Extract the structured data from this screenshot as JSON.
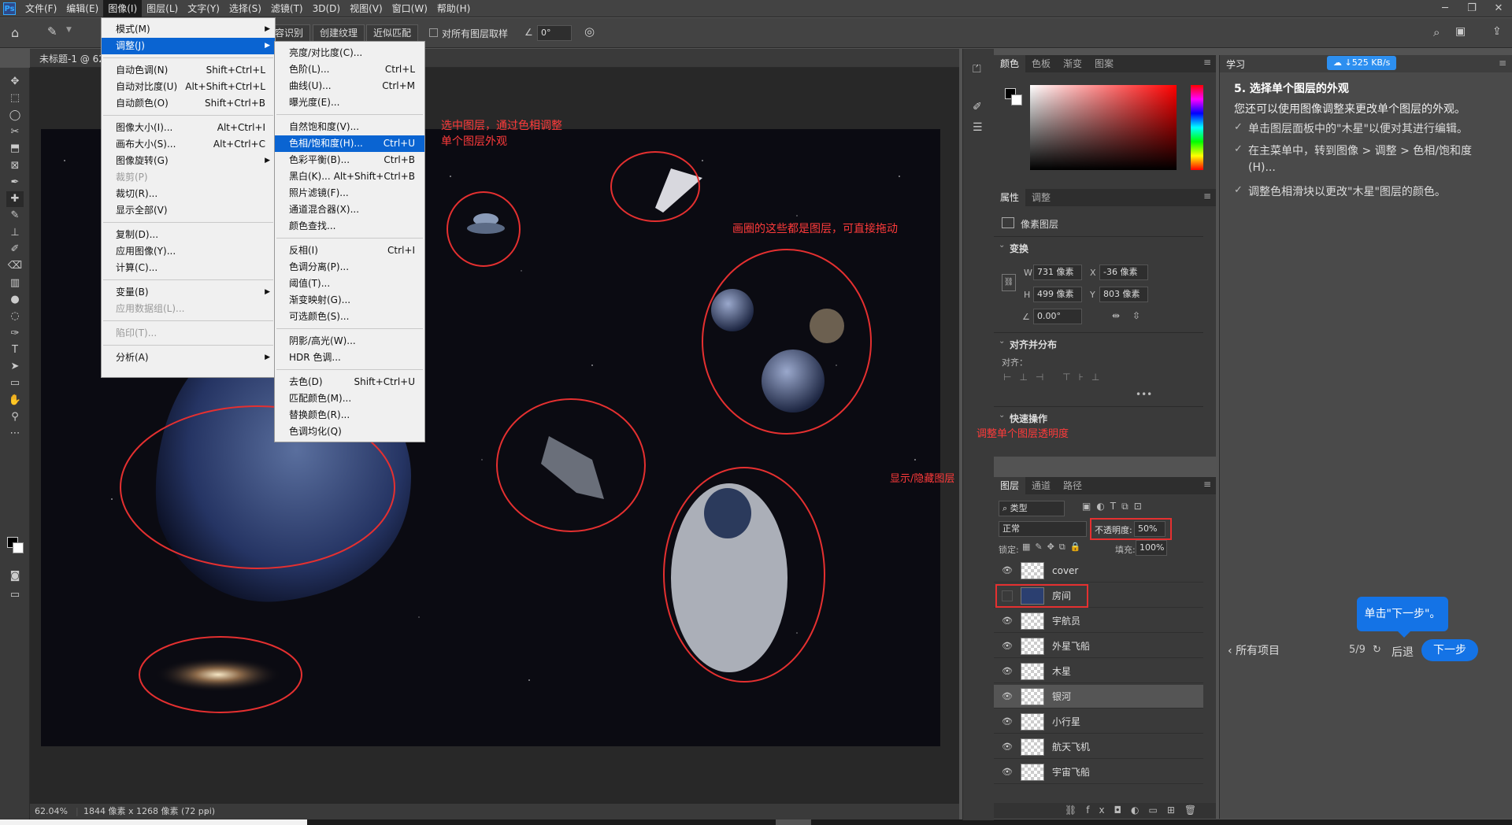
{
  "app": {
    "logo": "Ps"
  },
  "menubar": {
    "items": [
      "文件(F)",
      "编辑(E)",
      "图像(I)",
      "图层(L)",
      "文字(Y)",
      "选择(S)",
      "滤镜(T)",
      "3D(D)",
      "视图(V)",
      "窗口(W)",
      "帮助(H)"
    ],
    "active_index": 2
  },
  "options": {
    "btn_identify": "容识别",
    "btn_texture": "创建纹理",
    "btn_approx": "近似匹配",
    "sample_all": "对所有图层取样",
    "angle": "0°"
  },
  "document": {
    "tab_title": "未标题-1 @ 62",
    "zoom": "62.04%",
    "size_info": "1844 像素 x 1268 像素 (72 ppi)"
  },
  "image_menu": {
    "items": [
      {
        "label": "模式(M)",
        "shortcut": "",
        "sub": true
      },
      {
        "label": "调整(J)",
        "shortcut": "",
        "sub": true,
        "highlight": true
      },
      {
        "label": "自动色调(N)",
        "shortcut": "Shift+Ctrl+L"
      },
      {
        "label": "自动对比度(U)",
        "shortcut": "Alt+Shift+Ctrl+L"
      },
      {
        "label": "自动颜色(O)",
        "shortcut": "Shift+Ctrl+B"
      },
      {
        "label": "图像大小(I)...",
        "shortcut": "Alt+Ctrl+I"
      },
      {
        "label": "画布大小(S)...",
        "shortcut": "Alt+Ctrl+C"
      },
      {
        "label": "图像旋转(G)",
        "shortcut": "",
        "sub": true
      },
      {
        "label": "裁剪(P)",
        "shortcut": "",
        "disabled": true
      },
      {
        "label": "裁切(R)...",
        "shortcut": ""
      },
      {
        "label": "显示全部(V)",
        "shortcut": ""
      },
      {
        "label": "复制(D)...",
        "shortcut": ""
      },
      {
        "label": "应用图像(Y)...",
        "shortcut": ""
      },
      {
        "label": "计算(C)...",
        "shortcut": ""
      },
      {
        "label": "变量(B)",
        "shortcut": "",
        "sub": true
      },
      {
        "label": "应用数据组(L)...",
        "shortcut": "",
        "disabled": true
      },
      {
        "label": "陷印(T)...",
        "shortcut": "",
        "disabled": true
      },
      {
        "label": "分析(A)",
        "shortcut": "",
        "sub": true
      }
    ]
  },
  "adjust_menu": {
    "items": [
      {
        "label": "亮度/对比度(C)...",
        "shortcut": ""
      },
      {
        "label": "色阶(L)...",
        "shortcut": "Ctrl+L"
      },
      {
        "label": "曲线(U)...",
        "shortcut": "Ctrl+M"
      },
      {
        "label": "曝光度(E)...",
        "shortcut": ""
      },
      {
        "label": "自然饱和度(V)...",
        "shortcut": ""
      },
      {
        "label": "色相/饱和度(H)...",
        "shortcut": "Ctrl+U",
        "highlight": true
      },
      {
        "label": "色彩平衡(B)...",
        "shortcut": "Ctrl+B"
      },
      {
        "label": "黑白(K)...",
        "shortcut": "Alt+Shift+Ctrl+B"
      },
      {
        "label": "照片滤镜(F)...",
        "shortcut": ""
      },
      {
        "label": "通道混合器(X)...",
        "shortcut": ""
      },
      {
        "label": "颜色查找...",
        "shortcut": ""
      },
      {
        "label": "反相(I)",
        "shortcut": "Ctrl+I"
      },
      {
        "label": "色调分离(P)...",
        "shortcut": ""
      },
      {
        "label": "阈值(T)...",
        "shortcut": ""
      },
      {
        "label": "渐变映射(G)...",
        "shortcut": ""
      },
      {
        "label": "可选颜色(S)...",
        "shortcut": ""
      },
      {
        "label": "阴影/高光(W)...",
        "shortcut": ""
      },
      {
        "label": "HDR 色调...",
        "shortcut": ""
      },
      {
        "label": "去色(D)",
        "shortcut": "Shift+Ctrl+U"
      },
      {
        "label": "匹配颜色(M)...",
        "shortcut": ""
      },
      {
        "label": "替换颜色(R)...",
        "shortcut": ""
      },
      {
        "label": "色调均化(Q)",
        "shortcut": ""
      }
    ]
  },
  "annotations": {
    "hue": "选中图层，通过色相调整\n单个图层外观",
    "layers_drag": "画圈的这些都是图层，可直接拖动",
    "opacity": "调整单个图层透明度",
    "visibility": "显示/隐藏图层"
  },
  "color_panel": {
    "tabs": [
      "颜色",
      "色板",
      "渐变",
      "图案"
    ]
  },
  "props_panel": {
    "tabs": [
      "属性",
      "调整"
    ],
    "kind": "像素图层",
    "transform_title": "变换",
    "w_label": "W",
    "w_value": "731 像素",
    "x_label": "X",
    "x_value": "-36 像素",
    "h_label": "H",
    "h_value": "499 像素",
    "y_label": "Y",
    "y_value": "803 像素",
    "angle_value": "0.00°",
    "align_title": "对齐并分布",
    "align_label": "对齐：",
    "quick_title": "快速操作"
  },
  "layers_panel": {
    "tabs": [
      "图层",
      "通道",
      "路径"
    ],
    "filter": "类型",
    "blend": "正常",
    "opacity_label": "不透明度:",
    "opacity_value": "50%",
    "lock_label": "锁定:",
    "fill_label": "填充:",
    "fill_value": "100%",
    "layers": [
      {
        "name": "cover",
        "visible": true
      },
      {
        "name": "房间",
        "visible": false
      },
      {
        "name": "宇航员",
        "visible": true
      },
      {
        "name": "外星飞船",
        "visible": true
      },
      {
        "name": "木星",
        "visible": true
      },
      {
        "name": "银河",
        "visible": true,
        "selected": true
      },
      {
        "name": "小行星",
        "visible": true
      },
      {
        "name": "航天飞机",
        "visible": true
      },
      {
        "name": "宇宙飞船",
        "visible": true
      }
    ]
  },
  "learn_panel": {
    "tab": "学习",
    "speed": "525 KB/s",
    "step_title": "5. 选择单个图层的外观",
    "intro": "您还可以使用图像调整来更改单个图层的外观。",
    "bullets": [
      "单击图层面板中的\"木星\"以便对其进行编辑。",
      "在主菜单中，转到图像 > 调整 > 色相/饱和度 (H)...",
      "调整色相滑块以更改\"木星\"图层的颜色。"
    ],
    "tooltip": "单击\"下一步\"。",
    "all_items": "所有项目",
    "progress": "5/9",
    "back": "后退",
    "next": "下一步"
  },
  "colors": {
    "accent": "#0a64d2",
    "annotation": "#ff3b3b",
    "next_btn": "#1473e6"
  }
}
